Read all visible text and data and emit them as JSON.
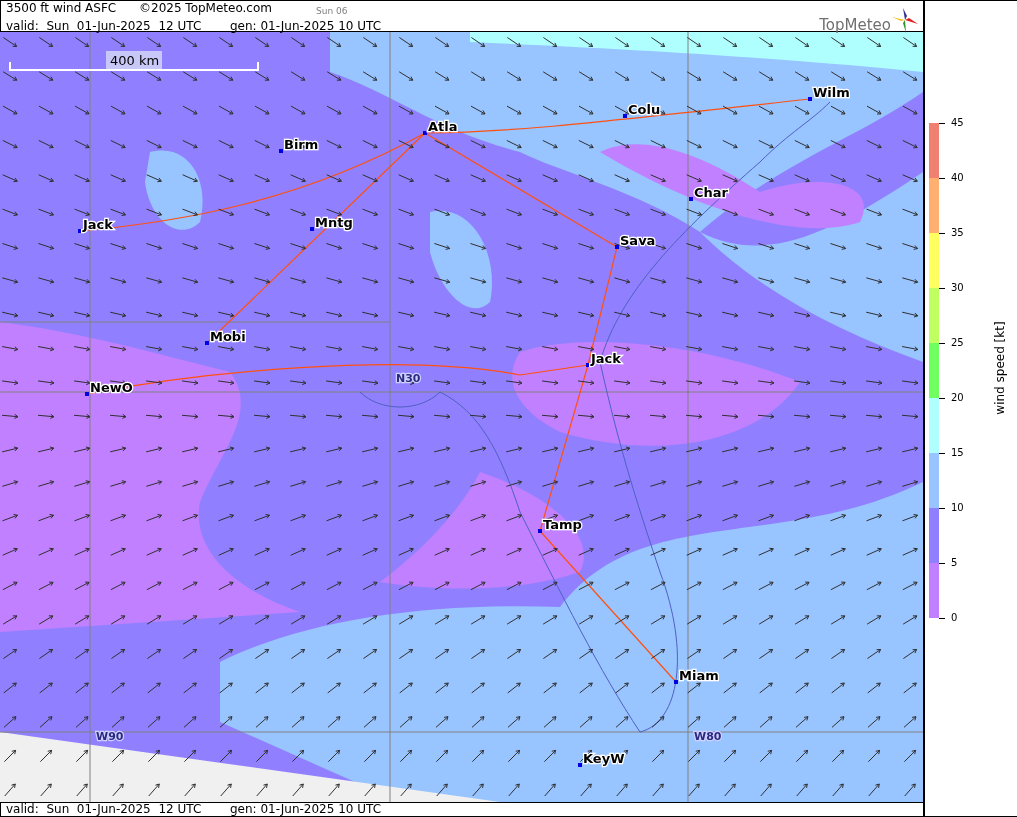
{
  "header": {
    "title": "3500 ft wind ASFC",
    "copyright": "©2025 TopMeteo.com",
    "day_tag": "Sun 06",
    "valid": "valid:  Sun  01-Jun-2025  12 UTC",
    "generated": "gen: 01-Jun-2025 10 UTC",
    "logo": "TopMeteo"
  },
  "map": {
    "scale": "400 km",
    "cities": [
      {
        "name": "Birm"
      },
      {
        "name": "Atla"
      },
      {
        "name": "Colu"
      },
      {
        "name": "Wilm"
      },
      {
        "name": "Char"
      },
      {
        "name": "Jack"
      },
      {
        "name": "Mntg"
      },
      {
        "name": "Sava"
      },
      {
        "name": "Mobi"
      },
      {
        "name": "Jack"
      },
      {
        "name": "NewO"
      },
      {
        "name": "Tamp"
      },
      {
        "name": "Miam"
      },
      {
        "name": "KeyW"
      }
    ],
    "grid_labels": [
      "N30",
      "W90",
      "W80"
    ]
  },
  "legend": {
    "title": "wind speed [kt]",
    "ticks": [
      "45",
      "40",
      "35",
      "30",
      "25",
      "20",
      "15",
      "10",
      "5",
      "0"
    ],
    "bins": [
      {
        "color": "#f08070"
      },
      {
        "color": "#ffb070"
      },
      {
        "color": "#ffff60"
      },
      {
        "color": "#c0ff60"
      },
      {
        "color": "#70ff60"
      },
      {
        "color": "#b0ffff"
      },
      {
        "color": "#98c4ff"
      },
      {
        "color": "#9080ff"
      },
      {
        "color": "#c080ff"
      }
    ]
  },
  "footer": {
    "valid": "valid:  Sun  01-Jun-2025  12 UTC",
    "generated": "gen: 01-Jun-2025 10 UTC"
  }
}
